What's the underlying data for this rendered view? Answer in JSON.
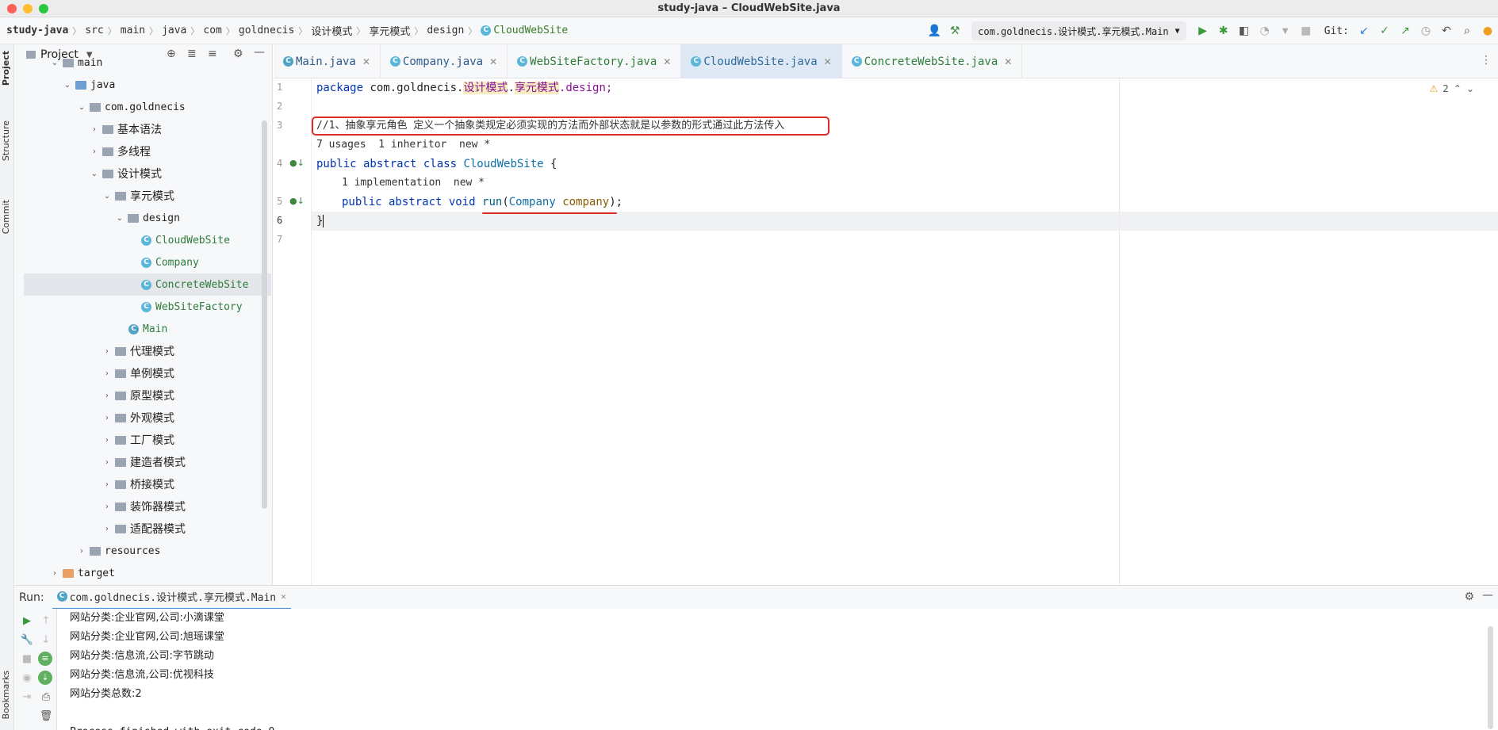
{
  "window": {
    "title": "study-java – CloudWebSite.java"
  },
  "breadcrumb": [
    "study-java",
    "src",
    "main",
    "java",
    "com",
    "goldnecis",
    "设计模式",
    "享元模式",
    "design"
  ],
  "breadcrumb_last": "CloudWebSite",
  "toolbar": {
    "run_config": "com.goldnecis.设计模式.享元模式.Main",
    "git_label": "Git:"
  },
  "side_labels": {
    "project": "Project",
    "structure": "Structure",
    "commit": "Commit",
    "bookmarks": "Bookmarks"
  },
  "project_panel": {
    "title": "Project"
  },
  "tree": {
    "main": "main",
    "java": "java",
    "com_goldnecis": "com.goldnecis",
    "basic": "基本语法",
    "thread": "多线程",
    "design_pattern": "设计模式",
    "flyweight": "享元模式",
    "design": "design",
    "cloudwebsite": "CloudWebSite",
    "company": "Company",
    "concretewebsite": "ConcreteWebSite",
    "websitefactory": "WebSiteFactory",
    "main_cls": "Main",
    "proxy": "代理模式",
    "singleton": "单例模式",
    "prototype": "原型模式",
    "facade": "外观模式",
    "factory": "工厂模式",
    "builder": "建造者模式",
    "bridge": "桥接模式",
    "decorator": "装饰器模式",
    "adapter": "适配器模式",
    "resources": "resources",
    "target": "target"
  },
  "tabs": [
    "Main.java",
    "Company.java",
    "WebSiteFactory.java",
    "CloudWebSite.java",
    "ConcreteWebSite.java"
  ],
  "editor": {
    "line_numbers": [
      "1",
      "2",
      "3",
      "4",
      "5",
      "6",
      "7"
    ],
    "package_kw": "package",
    "package_pre": " com.goldnecis.",
    "package_hl1": "设计模式",
    "dot": ".",
    "package_hl2": "享元模式",
    "package_post": ".design;",
    "comment": "//1、抽象享元角色 定义一个抽象类规定必须实现的方法而外部状态就是以参数的形式通过此方法传入",
    "hint_class": "7 usages  1 inheritor  new *",
    "class_kw": "public abstract class",
    "class_name": "CloudWebSite",
    "class_open": " {",
    "hint_method": "1 implementation  new *",
    "method_kw": "public abstract void",
    "method_name": "run",
    "method_open": "(",
    "param_type": "Company",
    "param_name": "company",
    "method_close": ");",
    "close_brace": "}",
    "warning_count": "2"
  },
  "run_panel": {
    "label": "Run:",
    "tab": "com.goldnecis.设计模式.享元模式.Main",
    "output": [
      "网站分类:企业官网,公司:小滴课堂",
      "网站分类:企业官网,公司:旭瑶课堂",
      "网站分类:信息流,公司:字节跳动",
      "网站分类:信息流,公司:优视科技",
      "网站分类总数:2",
      "",
      "Process finished with exit code 0"
    ]
  },
  "colors": {
    "accent": "#3d8cd8",
    "highlight_box": "#e02b2b",
    "class_icon": "#5bb7d9"
  }
}
